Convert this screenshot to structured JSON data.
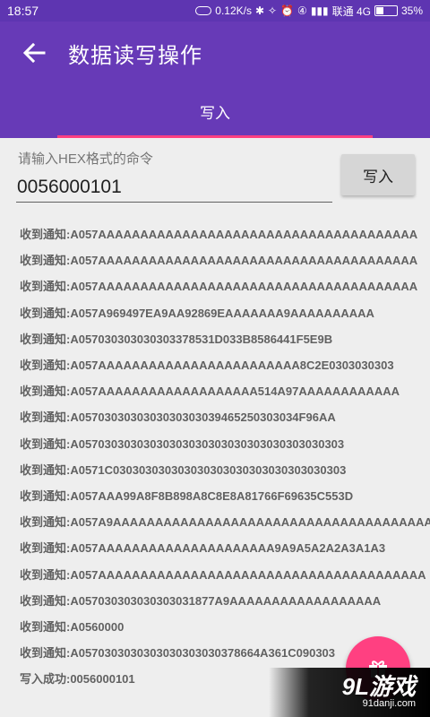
{
  "status_bar": {
    "time": "18:57",
    "network_speed": "0.12K/s",
    "carrier": "联通 4G",
    "battery": "35%"
  },
  "app_bar": {
    "back_icon": "arrow-left-icon",
    "title": "数据读写操作"
  },
  "tabs": [
    {
      "label": "写入",
      "selected": true
    }
  ],
  "form": {
    "hint": "请输入HEX格式的命令",
    "input_value": "0056000101",
    "button_label": "写入"
  },
  "log": [
    "收到通知:A057AAAAAAAAAAAAAAAAAAAAAAAAAAAAAAAAAAAAAA",
    "收到通知:A057AAAAAAAAAAAAAAAAAAAAAAAAAAAAAAAAAAAAAA",
    "收到通知:A057AAAAAAAAAAAAAAAAAAAAAAAAAAAAAAAAAAAAAA",
    "收到通知:A057A969497EA9AA92869EAAAAAAA9AAAAAAAAAA",
    "收到通知:A057030303030303378531D033B8586441F5E9B",
    "收到通知:A057AAAAAAAAAAAAAAAAAAAAAAAA8C2E0303030303",
    "收到通知:A057AAAAAAAAAAAAAAAAAAA514A97AAAAAAAAAAAA",
    "收到通知:A0570303030303030303039465250303034F96AA",
    "收到通知:A05703030303030303030303030303030303030303",
    "收到通知:A0571C030303030303030303030303030303030303",
    "收到通知:A057AAA99A8F8B898A8C8E8A81766F69635C553D",
    "收到通知:A057A9AAAAAAAAAAAAAAAAAAAAAAAAAAAAAAAAAAAAAA",
    "收到通知:A057AAAAAAAAAAAAAAAAAAAAA9A9A5A2A2A3A1A3",
    "收到通知:A057AAAAAAAAAAAAAAAAAAAAAAAAAAAAAAAAAAAAAAA",
    "收到通知:A057030303030303031877A9AAAAAAAAAAAAAAAAAA",
    "收到通知:A0560000",
    "收到通知:A0570303030303030303030378664A361C090303",
    "写入成功:0056000101"
  ],
  "fab": {
    "icon": "gift-icon"
  },
  "watermark": {
    "main": "9L游戏",
    "sub": "91danji.com"
  },
  "colors": {
    "primary": "#673ab7",
    "status_bar": "#5e35b1",
    "accent": "#ff4081",
    "background": "#eeeeee",
    "log_text": "#616161"
  }
}
